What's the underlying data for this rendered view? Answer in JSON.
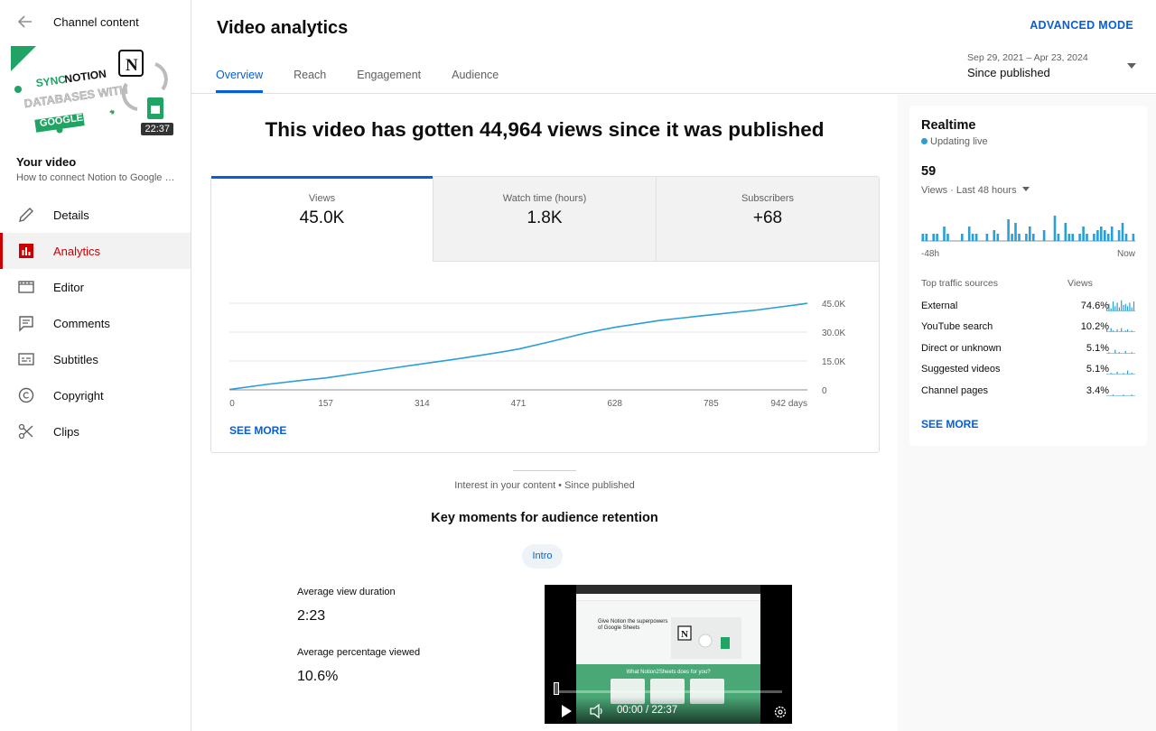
{
  "sidebar": {
    "header_title": "Channel content",
    "thumbnail": {
      "duration": "22:37",
      "art_lines": [
        "SYNC NOTION",
        "DATABASES WITH",
        "GOOGLE SHEETS"
      ],
      "logo_text": "N"
    },
    "your_video_label": "Your video",
    "video_title": "How to connect Notion to Google Sh...",
    "items": [
      {
        "label": "Details",
        "icon": "pencil-icon",
        "active": false
      },
      {
        "label": "Analytics",
        "icon": "analytics-icon",
        "active": true
      },
      {
        "label": "Editor",
        "icon": "film-editor-icon",
        "active": false
      },
      {
        "label": "Comments",
        "icon": "comment-icon",
        "active": false
      },
      {
        "label": "Subtitles",
        "icon": "subtitles-icon",
        "active": false
      },
      {
        "label": "Copyright",
        "icon": "copyright-icon",
        "active": false
      },
      {
        "label": "Clips",
        "icon": "scissors-icon",
        "active": false
      }
    ]
  },
  "header": {
    "title": "Video analytics",
    "advanced_mode": "ADVANCED MODE",
    "tabs": [
      "Overview",
      "Reach",
      "Engagement",
      "Audience"
    ],
    "active_tab": "Overview",
    "date_range": {
      "dates": "Sep 29, 2021 – Apr 23, 2024",
      "value": "Since published"
    }
  },
  "main": {
    "headline": "This video has gotten 44,964 views since it was published",
    "metrics": [
      {
        "label": "Views",
        "value": "45.0K",
        "active": true
      },
      {
        "label": "Watch time (hours)",
        "value": "1.8K",
        "active": false
      },
      {
        "label": "Subscribers",
        "value": "+68",
        "active": false
      }
    ],
    "see_more": "SEE MORE",
    "interest_text": "Interest in your content • Since published",
    "key_moments_title": "Key moments for audience retention",
    "chip": "Intro",
    "avg_view_duration_label": "Average view duration",
    "avg_view_duration": "2:23",
    "avg_pct_viewed_label": "Average percentage viewed",
    "avg_pct_viewed": "10.6%",
    "player": {
      "time": "00:00 / 22:37",
      "screen_heading": "Give Notion the superpowers of Google Sheets",
      "screen_subheading": "What Notion2Sheets does for you?"
    }
  },
  "realtime": {
    "title": "Realtime",
    "live_label": "Updating live",
    "views": "59",
    "metric_label": "Views · Last 48 hours",
    "axis_left": "-48h",
    "axis_right": "Now",
    "bars": [
      1,
      1,
      0,
      1,
      1,
      0,
      3,
      1,
      0,
      0,
      0,
      1,
      0,
      3,
      1,
      1,
      0,
      0,
      1,
      0,
      2,
      1,
      0,
      0,
      5,
      1,
      4,
      1,
      0,
      1,
      3,
      1,
      0,
      0,
      2,
      0,
      0,
      6,
      1,
      0,
      4,
      1,
      1,
      0,
      1,
      3,
      1,
      0,
      1,
      2,
      3,
      2,
      1,
      3,
      0,
      2,
      4,
      1,
      0,
      1
    ],
    "traffic_header": "Top traffic sources",
    "traffic_views_header": "Views",
    "traffic": [
      {
        "name": "External",
        "pct": "74.6%"
      },
      {
        "name": "YouTube search",
        "pct": "10.2%"
      },
      {
        "name": "Direct or unknown",
        "pct": "5.1%"
      },
      {
        "name": "Suggested videos",
        "pct": "5.1%"
      },
      {
        "name": "Channel pages",
        "pct": "3.4%"
      }
    ],
    "see_more": "SEE MORE"
  },
  "chart_data": {
    "type": "line",
    "series": [
      {
        "x": [
          0,
          60,
          120,
          157,
          200,
          260,
          314,
          380,
          440,
          471,
          520,
          580,
          628,
          700,
          785,
          860,
          942
        ],
        "values": [
          200,
          2800,
          5000,
          6200,
          8200,
          11000,
          13500,
          16500,
          19500,
          21200,
          24800,
          29500,
          32500,
          36000,
          39000,
          41500,
          44964
        ]
      }
    ],
    "x_ticks": [
      "0",
      "157",
      "314",
      "471",
      "628",
      "785",
      "942 days"
    ],
    "y_ticks": [
      "0",
      "15.0K",
      "30.0K",
      "45.0K"
    ],
    "xlim": [
      0,
      942
    ],
    "ylim": [
      0,
      45000
    ],
    "color": "#2a9fd6",
    "grid": true
  }
}
